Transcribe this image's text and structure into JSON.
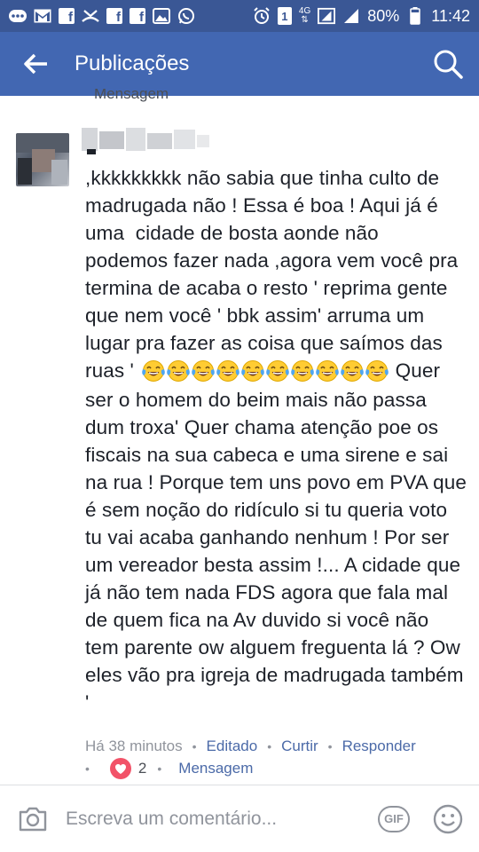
{
  "status_bar": {
    "battery_percent": "80%",
    "time": "11:42",
    "sim_label": "1",
    "network_label": "4G"
  },
  "app_bar": {
    "title": "Publicações"
  },
  "previous_item": {
    "message_link": "Mensagem"
  },
  "comment": {
    "text_before_emojis": ",kkkkkkkkk não sabia que tinha culto de madrugada não ! Essa é boa ! Aqui já é uma  cidade de bosta aonde não podemos fazer nada ,agora vem você pra termina de acaba o resto ' reprima gente que nem você ' bbk assim' arruma um lugar pra fazer as coisa que saímos das ruas ' ",
    "emoji_count": 10,
    "emoji_name": "face-with-tears-of-joy",
    "text_after_emojis": "Quer ser o homem do beim mais não passa dum troxa' Quer chama atenção poe os fiscais na sua cabeca e uma sirene e sai na rua ! Porque tem uns povo em PVA que é sem noção do ridículo si tu queria voto tu vai acaba ganhando nenhum ! Por ser um vereador besta assim !... A cidade que já não tem nada FDS agora que fala mal de quem fica na Av duvido si você não tem parente ow alguem freguenta lá ? Ow eles vão pra igreja de madrugada também '",
    "time_ago": "Há 38 minutos",
    "edited_label": "Editado",
    "like_label": "Curtir",
    "reply_label": "Responder",
    "reaction_count": "2",
    "message_label": "Mensagem"
  },
  "composer": {
    "placeholder": "Escreva um comentário...",
    "gif_label": "GIF"
  },
  "colors": {
    "status_bar": "#3a5795",
    "app_bar": "#4267b2",
    "link": "#4b6aa8",
    "meta_gray": "#90949c",
    "heart": "#f25268"
  }
}
